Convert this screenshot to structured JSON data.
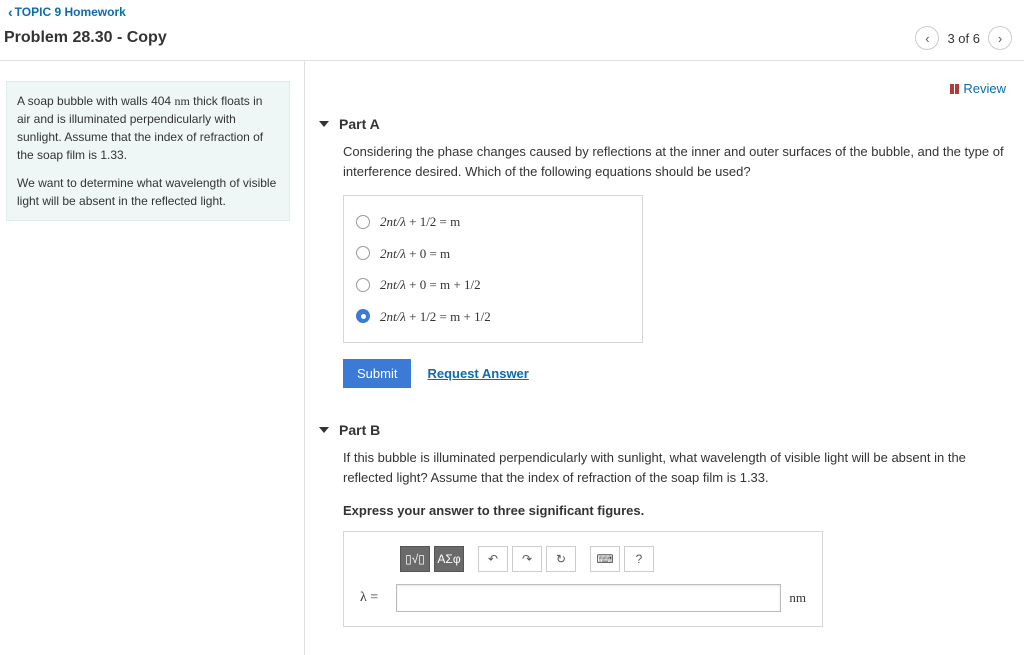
{
  "nav": {
    "back_label": "TOPIC 9 Homework",
    "problem_title": "Problem 28.30 - Copy",
    "page_indicator": "3 of 6",
    "review_label": "Review"
  },
  "prompt": {
    "p1_a": "A soap bubble with walls 404 ",
    "p1_unit": "nm",
    "p1_b": " thick floats in air and is illuminated perpendicularly with sunlight. Assume that the index of refraction of the soap film is 1.33.",
    "p2": "We want to determine what wavelength of visible light will be absent in the reflected light."
  },
  "partA": {
    "title": "Part A",
    "question": "Considering the phase changes caused by reflections at the inner and outer surfaces of the bubble, and the type of interference desired. Which of the following equations should be used?",
    "options": [
      {
        "lhs": "2nt/λ",
        "mid": " + 1/2 = m",
        "selected": false
      },
      {
        "lhs": "2nt/λ",
        "mid": " + 0 = m",
        "selected": false
      },
      {
        "lhs": "2nt/λ",
        "mid": " + 0 = m + 1/2",
        "selected": false
      },
      {
        "lhs": "2nt/λ",
        "mid": " + 1/2 = m + 1/2",
        "selected": true
      }
    ],
    "submit_label": "Submit",
    "request_label": "Request Answer"
  },
  "partB": {
    "title": "Part B",
    "question": "If this bubble is illuminated perpendicularly with sunlight, what wavelength of visible light will be absent in the reflected light? Assume that the index of refraction of the soap film is 1.33.",
    "instruction": "Express your answer to three significant figures.",
    "toolbar": {
      "templates": "▯√▯",
      "symbols": "ΑΣφ",
      "undo": "↶",
      "redo": "↷",
      "reset": "↻",
      "keyboard": "⌨",
      "help": "?"
    },
    "var_label": "λ =",
    "unit": "nm",
    "value": ""
  }
}
